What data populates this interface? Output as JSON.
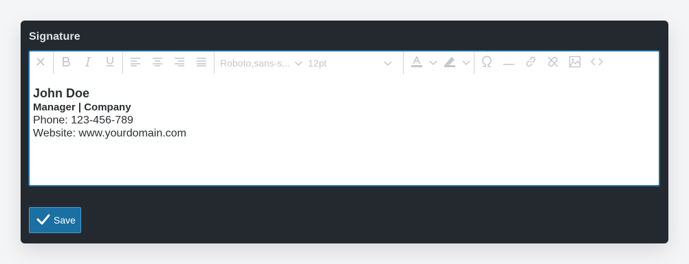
{
  "panel": {
    "title": "Signature"
  },
  "toolbar": {
    "font_family": "Roboto,sans-s...",
    "font_size": "12pt",
    "icons": [
      "clear-format-icon",
      "bold-icon",
      "italic-icon",
      "underline-icon",
      "align-left-icon",
      "align-center-icon",
      "align-right-icon",
      "align-justify-icon",
      "text-color-icon",
      "highlight-icon",
      "special-char-icon",
      "horizontal-rule-icon",
      "link-icon",
      "unlink-icon",
      "image-icon",
      "source-code-icon"
    ]
  },
  "signature": {
    "name": "John Doe",
    "title": "Manager | Company",
    "phone": "Phone: 123-456-789",
    "website": "Website: www.yourdomain.com"
  },
  "save_button": {
    "label": "Save"
  },
  "colors": {
    "panel_bg": "#23292e",
    "accent": "#1a6fa3",
    "editor_border": "#1b6fa0",
    "toolbar_icon": "#c2c7cc"
  }
}
